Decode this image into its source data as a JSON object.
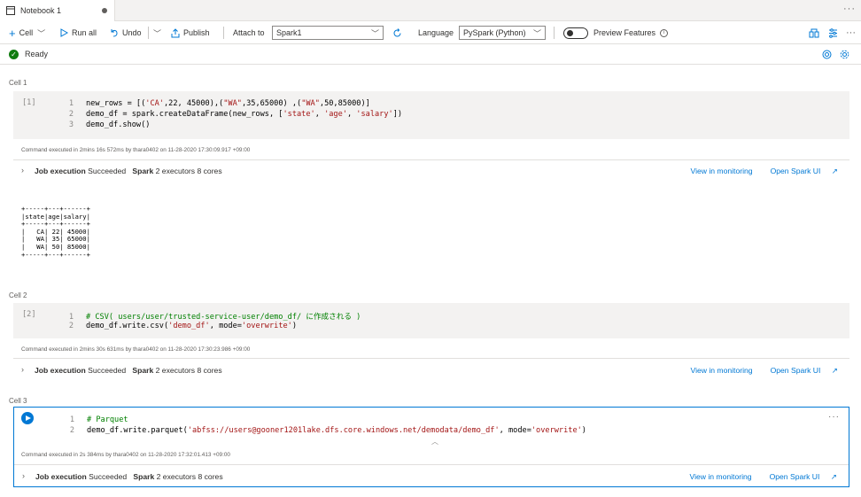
{
  "tab": {
    "title": "Notebook 1"
  },
  "toolbar": {
    "cell_label": "Cell",
    "run_all_label": "Run all",
    "undo_label": "Undo",
    "publish_label": "Publish",
    "attach_to_label": "Attach to",
    "attach_to_value": "Spark1",
    "language_label": "Language",
    "language_value": "PySpark (Python)",
    "preview_features_label": "Preview Features"
  },
  "status": {
    "text": "Ready"
  },
  "cells": [
    {
      "label": "Cell 1",
      "exec_count": "[1]",
      "meta": "Command executed in 2mins 16s 572ms by thara0402 on 11-28-2020 17:30:09.917 +09:00",
      "job": {
        "title": "Job execution",
        "status": "Succeeded",
        "spark": "Spark",
        "detail": "2 executors 8 cores"
      },
      "output": "+-----+---+------+\n|state|age|salary|\n+-----+---+------+\n|   CA| 22| 45000|\n|   WA| 35| 65000|\n|   WA| 50| 85000|\n+-----+---+------+"
    },
    {
      "label": "Cell 2",
      "exec_count": "[2]",
      "meta": "Command executed in 2mins 30s 631ms by thara0402 on 11-28-2020 17:30:23.986 +09:00",
      "job": {
        "title": "Job execution",
        "status": "Succeeded",
        "spark": "Spark",
        "detail": "2 executors 8 cores"
      }
    },
    {
      "label": "Cell 3",
      "meta": "Command executed in 2s 384ms by thara0402 on 11-28-2020 17:32:01.413 +09:00",
      "job": {
        "title": "Job execution",
        "status": "Succeeded",
        "spark": "Spark",
        "detail": "2 executors 8 cores"
      }
    }
  ],
  "links": {
    "monitoring": "View in monitoring",
    "spark_ui": "Open Spark UI"
  },
  "code": {
    "c1l1a": "new_rows = [(",
    "c1l1b": "'CA'",
    "c1l1c": ",22, 45000),(",
    "c1l1d": "\"WA\"",
    "c1l1e": ",35,65000) ,(",
    "c1l1f": "\"WA\"",
    "c1l1g": ",50,85000)]",
    "c1l2a": "demo_df = spark.createDataFrame(new_rows, [",
    "c1l2b": "'state'",
    "c1l2c": ", ",
    "c1l2d": "'age'",
    "c1l2e": ", ",
    "c1l2f": "'salary'",
    "c1l2g": "])",
    "c1l3": "demo_df.show()",
    "c2l1": "# CSV( users/user/trusted-service-user/demo_df/ に作成される )",
    "c2l2a": "demo_df.write.csv(",
    "c2l2b": "'demo_df'",
    "c2l2c": ", mode=",
    "c2l2d": "'overwrite'",
    "c2l2e": ")",
    "c3l1": "# Parquet",
    "c3l2a": "demo_df.write.parquet(",
    "c3l2b": "'abfss://users@gooner1201lake.dfs.core.windows.net/demodata/demo_df'",
    "c3l2c": ", mode=",
    "c3l2d": "'overwrite'",
    "c3l2e": ")"
  },
  "line_numbers": [
    "1",
    "2",
    "3"
  ]
}
